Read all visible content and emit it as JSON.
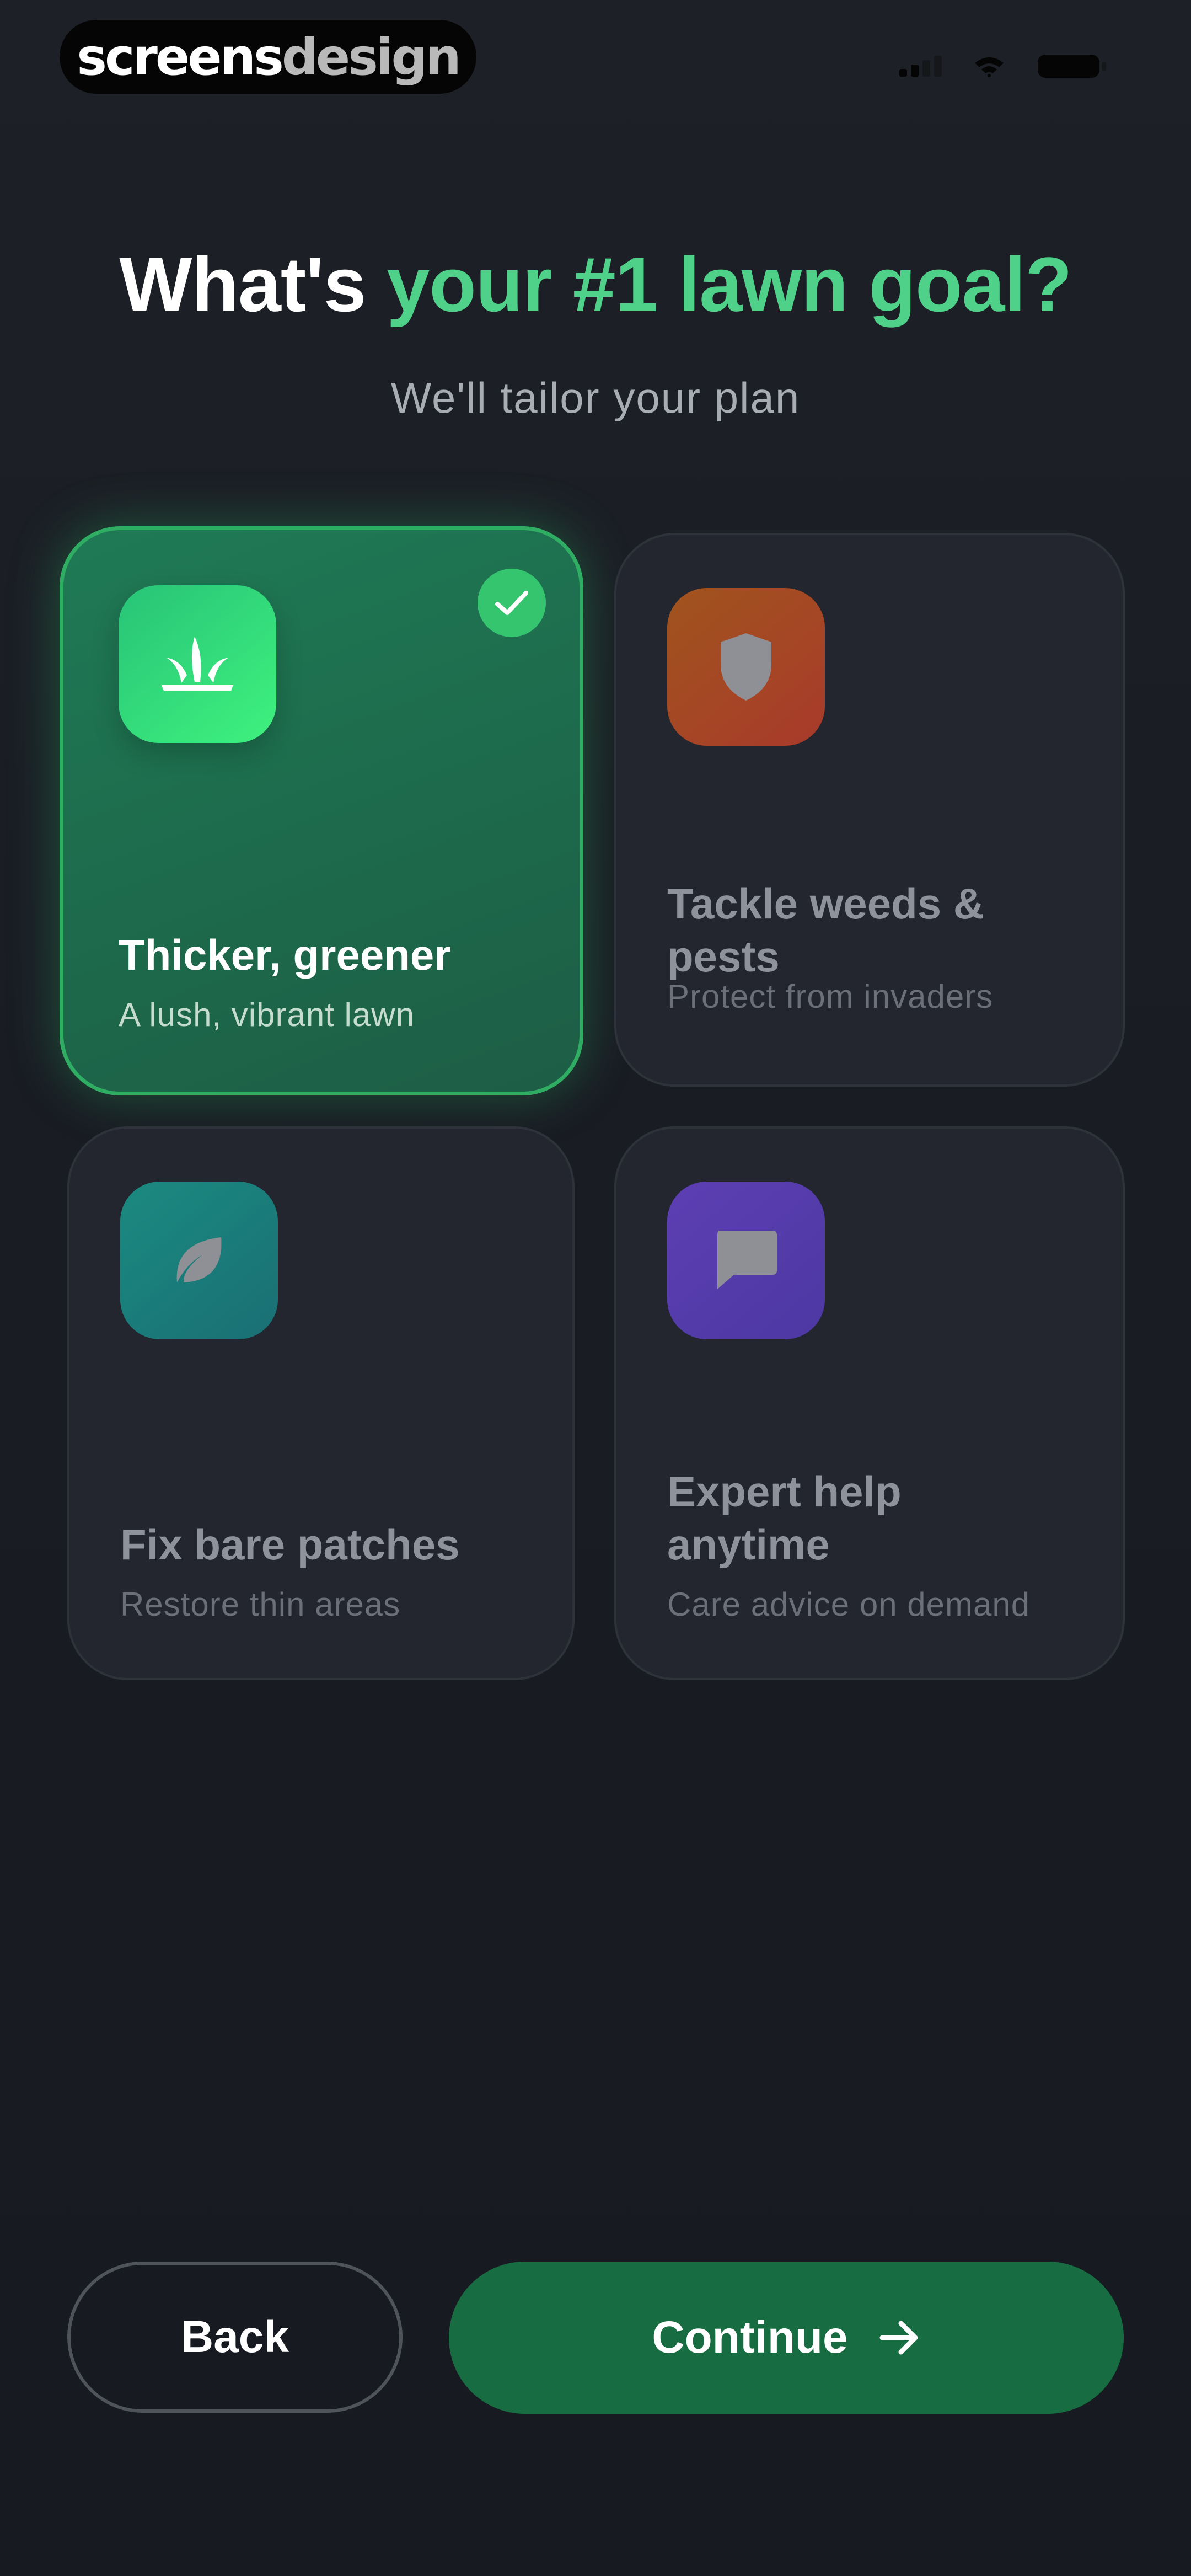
{
  "brand": {
    "part1": "screens",
    "part2": "design"
  },
  "header": {
    "title_white": "What's ",
    "title_green": "your #1 lawn goal?",
    "subtitle": "We'll tailor your plan"
  },
  "options": [
    {
      "title": "Thicker, greener",
      "subtitle": "A lush, vibrant lawn",
      "icon": "grass-icon",
      "selected": true
    },
    {
      "title_line1": "Tackle weeds &",
      "title_line2": "pests",
      "subtitle": "Protect from invaders",
      "icon": "shield-icon",
      "selected": false
    },
    {
      "title": "Fix bare patches",
      "subtitle": "Restore thin areas",
      "icon": "leaf-icon",
      "selected": false
    },
    {
      "title_line1": "Expert help",
      "title_line2": "anytime",
      "subtitle": "Care advice on demand",
      "icon": "chat-bubble-icon",
      "selected": false
    }
  ],
  "buttons": {
    "back": "Back",
    "continue": "Continue"
  },
  "colors": {
    "accent": "#4fd18a",
    "primary_button": "#176c41",
    "background": "#1b1e25"
  }
}
